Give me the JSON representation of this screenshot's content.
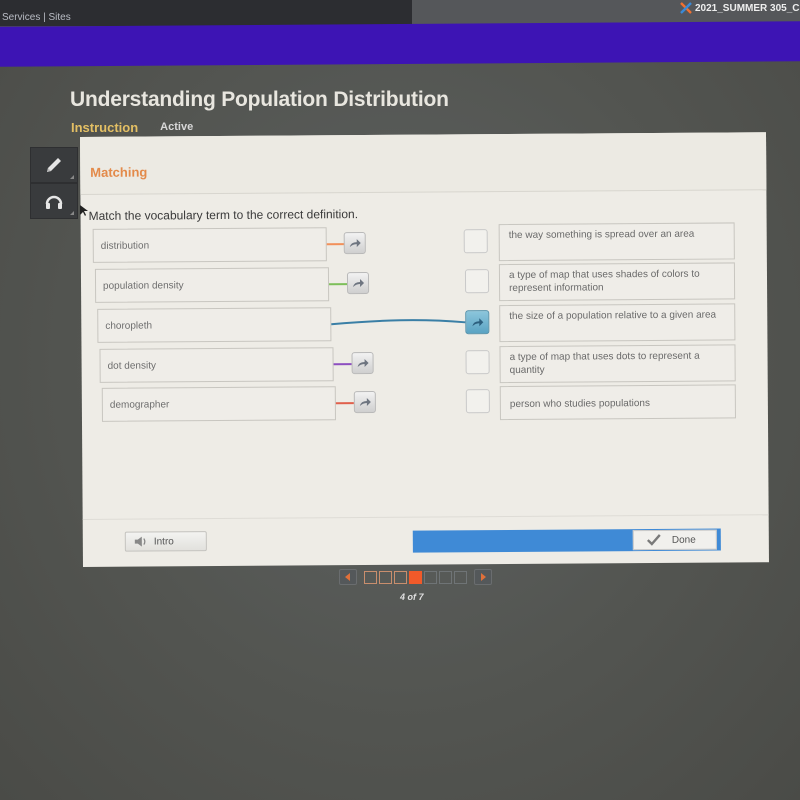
{
  "topbar": {
    "left_text": "Services | Sites",
    "course_title": "2021_SUMMER 305_C"
  },
  "header": {
    "title": "Understanding Population Distribution",
    "tabs": [
      {
        "label": "Instruction",
        "active": true
      },
      {
        "label": "Active",
        "active": false
      }
    ]
  },
  "tools": [
    {
      "icon": "pencil-icon"
    },
    {
      "icon": "headphones-icon"
    }
  ],
  "activity": {
    "type_label": "Matching",
    "instruction": "Match the vocabulary term to the correct definition.",
    "terms": [
      {
        "label": "distribution",
        "color": "#f2905a",
        "matched": false
      },
      {
        "label": "population density",
        "color": "#7dbf5a",
        "matched": false
      },
      {
        "label": "choropleth",
        "color": "#3a7fa6",
        "matched": true,
        "matched_to": 2
      },
      {
        "label": "dot density",
        "color": "#8d4fc0",
        "matched": false
      },
      {
        "label": "demographer",
        "color": "#e0604c",
        "matched": false
      }
    ],
    "definitions": [
      {
        "label": "the way something is spread over an area",
        "filled": false
      },
      {
        "label": "a type of map that uses shades of colors to represent information",
        "filled": false
      },
      {
        "label": "the size of a population relative to a given area",
        "filled": true
      },
      {
        "label": "a type of map that uses dots to represent a quantity",
        "filled": false
      },
      {
        "label": "person who studies populations",
        "filled": false
      }
    ]
  },
  "footer": {
    "intro_label": "Intro",
    "done_label": "Done"
  },
  "pager": {
    "current": 4,
    "total": 7,
    "label": "4 of 7"
  },
  "colors": {
    "accent_orange": "#e38a4a",
    "purple_band": "#3d14b4",
    "progress_blue": "#3f8ad6",
    "current_page": "#f15a2a"
  }
}
